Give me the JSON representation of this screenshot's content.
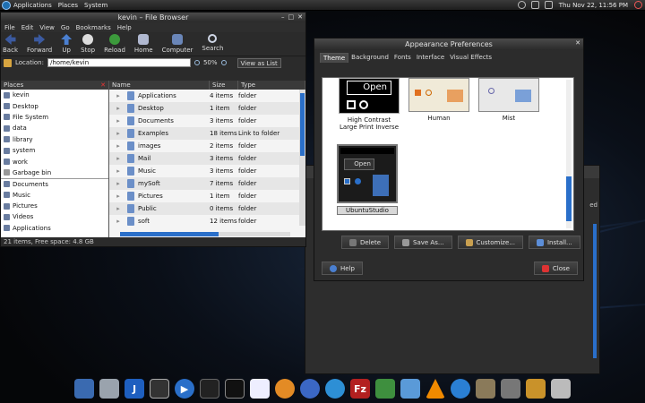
{
  "top_panel": {
    "menus": [
      "Applications",
      "Places",
      "System"
    ],
    "clock": "Thu Nov 22, 11:56 PM"
  },
  "file_browser": {
    "title": "kevin – File Browser",
    "menus": [
      "File",
      "Edit",
      "View",
      "Go",
      "Bookmarks",
      "Help"
    ],
    "toolbar": [
      "Back",
      "Forward",
      "Up",
      "Stop",
      "Reload",
      "Home",
      "Computer",
      "Search"
    ],
    "location_label": "Location:",
    "location_value": "/home/kevin",
    "zoom": "50%",
    "view_mode": "View as List",
    "places_header": "Places",
    "places": [
      "kevin",
      "Desktop",
      "File System",
      "data",
      "library",
      "system",
      "work",
      "Garbage bin",
      "Documents",
      "Music",
      "Pictures",
      "Videos",
      "Applications"
    ],
    "columns": [
      "Name",
      "Size",
      "Type"
    ],
    "rows": [
      {
        "name": "Applications",
        "size": "4 items",
        "type": "folder"
      },
      {
        "name": "Desktop",
        "size": "1 item",
        "type": "folder"
      },
      {
        "name": "Documents",
        "size": "3 items",
        "type": "folder"
      },
      {
        "name": "Examples",
        "size": "18 items",
        "type": "Link to folder"
      },
      {
        "name": "images",
        "size": "2 items",
        "type": "folder"
      },
      {
        "name": "Mail",
        "size": "3 items",
        "type": "folder"
      },
      {
        "name": "Music",
        "size": "3 items",
        "type": "folder"
      },
      {
        "name": "mySoft",
        "size": "7 items",
        "type": "folder"
      },
      {
        "name": "Pictures",
        "size": "1 item",
        "type": "folder"
      },
      {
        "name": "Public",
        "size": "0 items",
        "type": "folder"
      },
      {
        "name": "soft",
        "size": "12 items",
        "type": "folder"
      }
    ],
    "status": "21 items, Free space: 4.8 GB"
  },
  "appearance": {
    "title": "Appearance Preferences",
    "tabs": [
      "Theme",
      "Background",
      "Fonts",
      "Interface",
      "Visual Effects"
    ],
    "themes": [
      {
        "name": "High Contrast Large Print Inverse",
        "thumb_text": "Open"
      },
      {
        "name": "Human"
      },
      {
        "name": "Mist"
      },
      {
        "name": "UbuntuStudio",
        "thumb_text": "Open"
      }
    ],
    "buttons": [
      "Delete",
      "Save As...",
      "Customize...",
      "Install..."
    ],
    "help": "Help",
    "close": "Close"
  },
  "background_window": {
    "side_text": "ed"
  },
  "dock": [
    "finder",
    "drive",
    "sidebar",
    "camera",
    "player",
    "equalizer",
    "terminal",
    "document",
    "firefox",
    "thunderbird",
    "messenger",
    "filezilla",
    "vlc-network",
    "gimp-like",
    "vlc",
    "wiki",
    "gimp",
    "trash-folder",
    "archive",
    "trash"
  ]
}
